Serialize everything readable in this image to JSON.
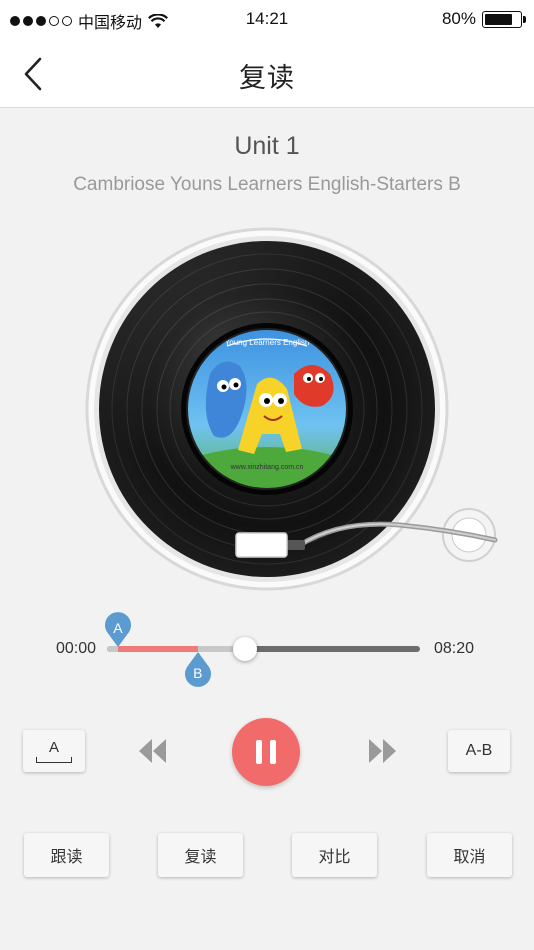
{
  "status_bar": {
    "carrier": "中国移动",
    "time": "14:21",
    "battery": "80%",
    "battery_level": 0.8,
    "signal_bars": 3,
    "signal_total": 5
  },
  "nav": {
    "title": "复读",
    "back_icon": "chevron-left-icon"
  },
  "track": {
    "unit": "Unit 1",
    "book": "Cambriose Youns Learners English-Starters B",
    "cover_caption": "www.xinzhitang.com.cn",
    "cover_banner": "Young Learners English"
  },
  "progress": {
    "current": "00:00",
    "total": "08:20",
    "position_fraction": 0.44,
    "a_fraction": 0.035,
    "b_fraction": 0.29,
    "marker_a": "A",
    "marker_b": "B"
  },
  "controls": {
    "a_label": "A",
    "ab_label": "A-B",
    "rewind_icon": "rewind-icon",
    "forward_icon": "fast-forward-icon",
    "play_icon": "pause-icon",
    "state": "playing"
  },
  "modes": [
    {
      "label": "跟读"
    },
    {
      "label": "复读"
    },
    {
      "label": "对比"
    },
    {
      "label": "取消"
    }
  ],
  "colors": {
    "accent": "#f26b6b",
    "ab_range": "#f07b7b",
    "marker": "#5b9bd0",
    "background": "#f2f2f2"
  }
}
